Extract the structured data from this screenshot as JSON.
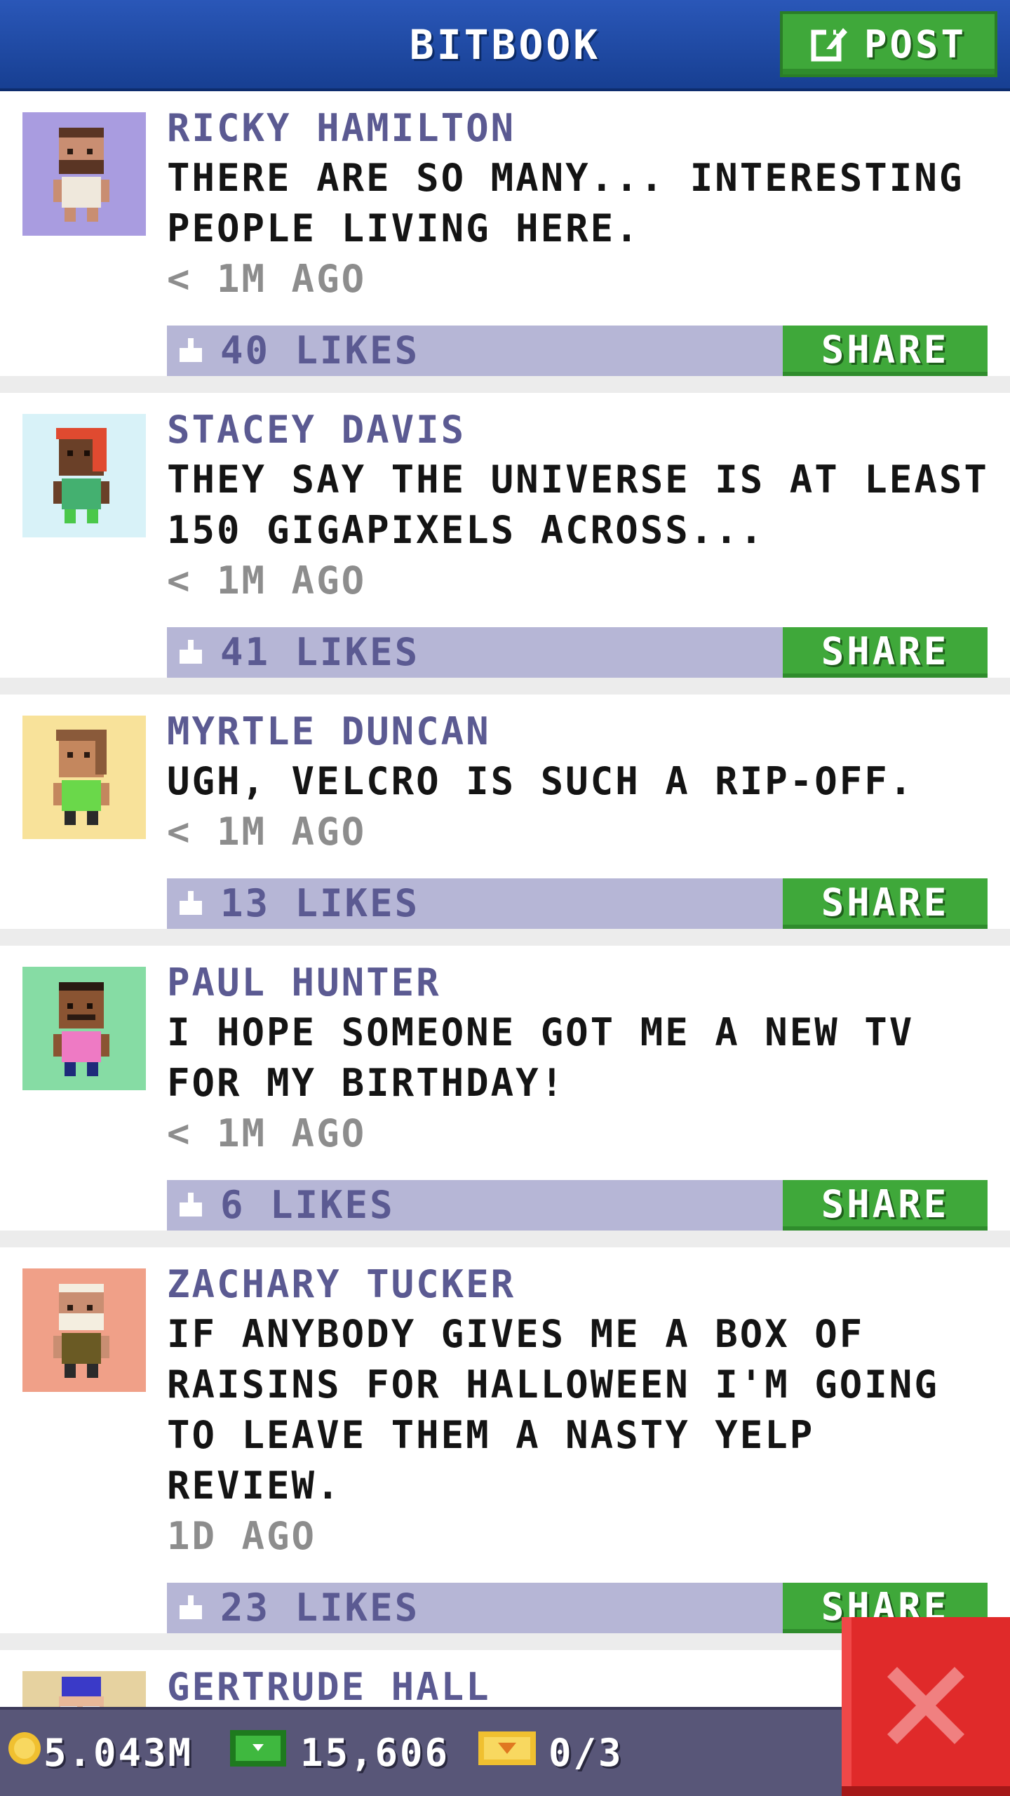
{
  "header": {
    "title": "BITBOOK",
    "post_label": "POST"
  },
  "feed": [
    {
      "author": "RICKY HAMILTON",
      "message": "THERE ARE SO MANY... INTERESTING PEOPLE LIVING HERE.",
      "time": "< 1M AGO",
      "likes": "40 LIKES",
      "share_label": "SHARE",
      "avatar_bg": "#a99ce0"
    },
    {
      "author": "STACEY DAVIS",
      "message": "THEY SAY THE UNIVERSE IS AT LEAST 150 GIGAPIXELS ACROSS...",
      "time": "< 1M AGO",
      "likes": "41 LIKES",
      "share_label": "SHARE",
      "avatar_bg": "#d8f2f8"
    },
    {
      "author": "MYRTLE DUNCAN",
      "message": "UGH, VELCRO IS SUCH A RIP-OFF.",
      "time": "< 1M AGO",
      "likes": "13 LIKES",
      "share_label": "SHARE",
      "avatar_bg": "#f8e29a"
    },
    {
      "author": "PAUL HUNTER",
      "message": "I HOPE SOMEONE GOT ME A NEW TV FOR MY BIRTHDAY!",
      "time": "< 1M AGO",
      "likes": "6 LIKES",
      "share_label": "SHARE",
      "avatar_bg": "#86dca4"
    },
    {
      "author": "ZACHARY TUCKER",
      "message": "IF ANYBODY GIVES ME A BOX OF RAISINS FOR HALLOWEEN I'M GOING TO LEAVE THEM A NASTY YELP REVIEW.",
      "time": "1D AGO",
      "likes": "23 LIKES",
      "share_label": "SHARE",
      "avatar_bg": "#f0a088"
    },
    {
      "author": "GERTRUDE HALL",
      "avatar_bg": "#e6d2a0"
    }
  ],
  "footer": {
    "coins": "5.043M",
    "bux": "15,606",
    "tickets": "0/3"
  },
  "colors": {
    "header": "#1f4aa6",
    "accent_green": "#3fa83a",
    "likes_bar": "#b6b6d6",
    "close_red": "#e02a2a"
  },
  "icons": {
    "post": "edit-icon",
    "like": "thumbs-up-icon",
    "coin": "coin-icon",
    "bux": "bux-icon",
    "ticket": "vip-ticket-icon",
    "close": "close-icon"
  }
}
